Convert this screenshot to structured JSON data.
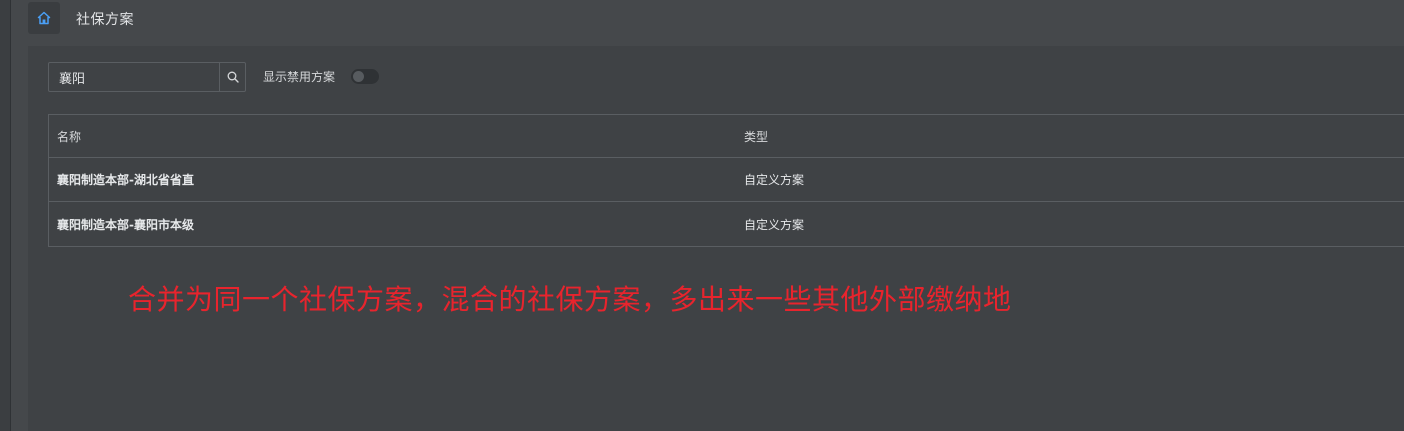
{
  "header": {
    "title": "社保方案",
    "home_icon": "home-icon"
  },
  "toolbar": {
    "search_value": "襄阳",
    "search_icon": "search-icon",
    "toggle_label": "显示禁用方案",
    "toggle_on": false
  },
  "table": {
    "columns": [
      "名称",
      "类型"
    ],
    "rows": [
      {
        "name": "襄阳制造本部-湖北省省直",
        "type": "自定义方案"
      },
      {
        "name": "襄阳制造本部-襄阳市本级",
        "type": "自定义方案"
      }
    ]
  },
  "annotation": {
    "text": "合并为同一个社保方案，混合的社保方案，多出来一些其他外部缴纳地",
    "color": "#e8242d"
  },
  "colors": {
    "accent": "#4a9ff5",
    "background": "#3f4245"
  }
}
